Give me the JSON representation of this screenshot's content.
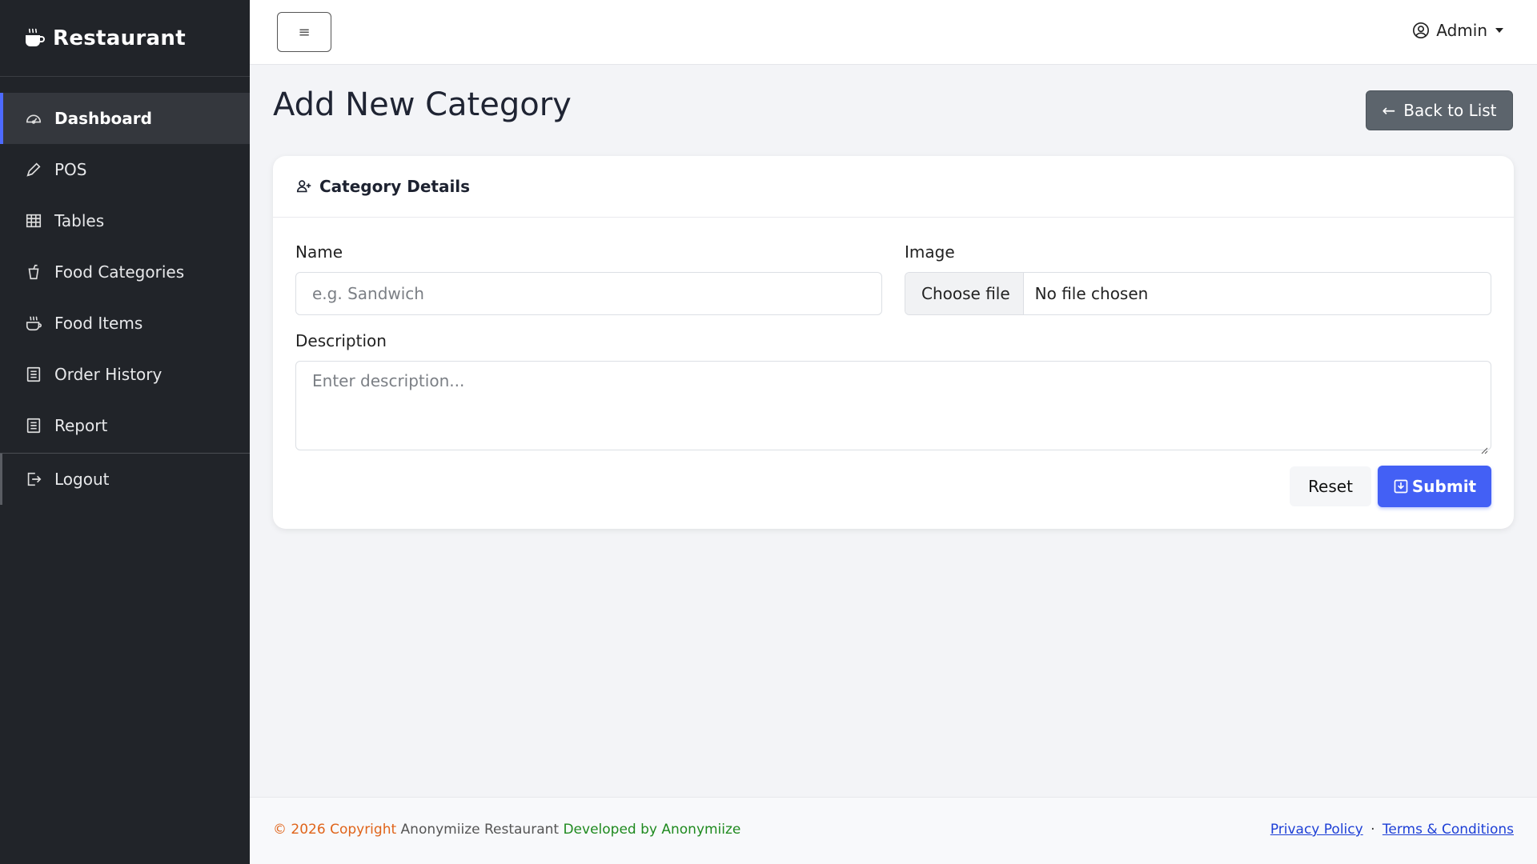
{
  "brand": {
    "name": "Restaurant",
    "icon": "coffee-icon"
  },
  "sidebar": {
    "items": [
      {
        "label": "Dashboard",
        "icon": "dashboard-icon",
        "active": true
      },
      {
        "label": "POS",
        "icon": "pencil-icon"
      },
      {
        "label": "Tables",
        "icon": "table-icon"
      },
      {
        "label": "Food Categories",
        "icon": "cup-icon"
      },
      {
        "label": "Food Items",
        "icon": "hot-dish-icon"
      },
      {
        "label": "Order History",
        "icon": "list-icon"
      },
      {
        "label": "Report",
        "icon": "report-icon"
      }
    ],
    "logout": {
      "label": "Logout",
      "icon": "logout-icon"
    }
  },
  "topbar": {
    "menu_icon": "≡",
    "user_label": "Admin"
  },
  "page": {
    "title": "Add New Category",
    "back_label": "Back to List",
    "back_arrow": "←"
  },
  "form": {
    "header": "Category Details",
    "name_label": "Name",
    "name_placeholder": "e.g. Sandwich",
    "image_label": "Image",
    "choose_file": "Choose file",
    "no_file": "No file chosen",
    "description_label": "Description",
    "description_placeholder": "Enter description...",
    "reset_label": "Reset",
    "submit_label": "Submit"
  },
  "footer": {
    "copyright": "© 2026 Copyright",
    "owner": "Anonymiize Restaurant",
    "developed": "Developed by Anonymiize",
    "privacy": "Privacy Policy",
    "separator": "·",
    "terms": "Terms & Conditions"
  },
  "colors": {
    "primary": "#4360f5",
    "sidebar": "#212429",
    "secondary_button": "#5c646c"
  }
}
